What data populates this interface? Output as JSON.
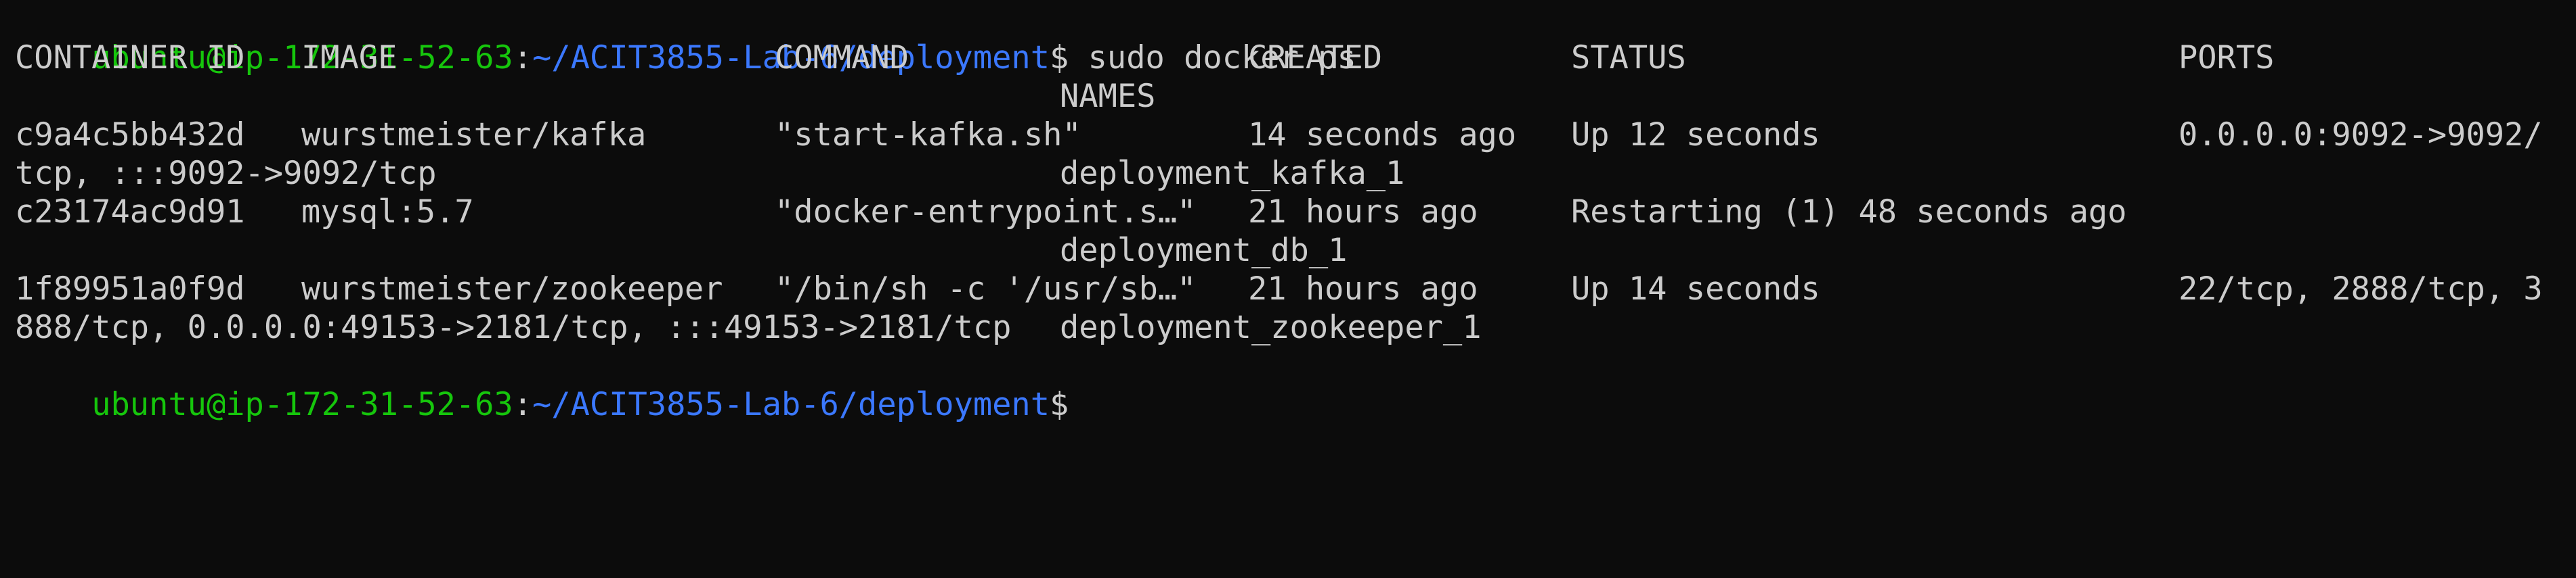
{
  "terminal": {
    "prompt_user": "ubuntu@ip-172-31-52-63",
    "prompt_colon": ":",
    "prompt_path": "~/ACIT3855-Lab-6/deployment",
    "prompt_symbol": "$",
    "command": " sudo docker ps",
    "colors": {
      "background": "#0c0c0c",
      "text": "#cccccc",
      "user": "#16c60c",
      "path": "#3b78ff"
    }
  },
  "table": {
    "headers": {
      "container_id": "CONTAINER ID",
      "image": "IMAGE",
      "command": "COMMAND",
      "created": "CREATED",
      "status": "STATUS",
      "ports": "PORTS",
      "names": "NAMES"
    },
    "rows": [
      {
        "container_id": "c9a4c5bb432d",
        "image": "wurstmeister/kafka",
        "command": "\"start-kafka.sh\"",
        "created": "14 seconds ago",
        "status": "Up 12 seconds",
        "ports": "0.0.0.0:9092->9092/",
        "wrap": "tcp, :::9092->9092/tcp",
        "names": "deployment_kafka_1"
      },
      {
        "container_id": "c23174ac9d91",
        "image": "mysql:5.7",
        "command": "\"docker-entrypoint.s…\"",
        "created": "21 hours ago",
        "status": "Restarting (1) 48 seconds ago",
        "ports": "",
        "wrap": "",
        "names": "deployment_db_1"
      },
      {
        "container_id": "1f89951a0f9d",
        "image": "wurstmeister/zookeeper",
        "command": "\"/bin/sh -c '/usr/sb…\"",
        "created": "21 hours ago",
        "status": "Up 14 seconds",
        "ports": "22/tcp, 2888/tcp, 3",
        "wrap": "888/tcp, 0.0.0.0:49153->2181/tcp, :::49153->2181/tcp",
        "names": "deployment_zookeeper_1"
      }
    ]
  }
}
